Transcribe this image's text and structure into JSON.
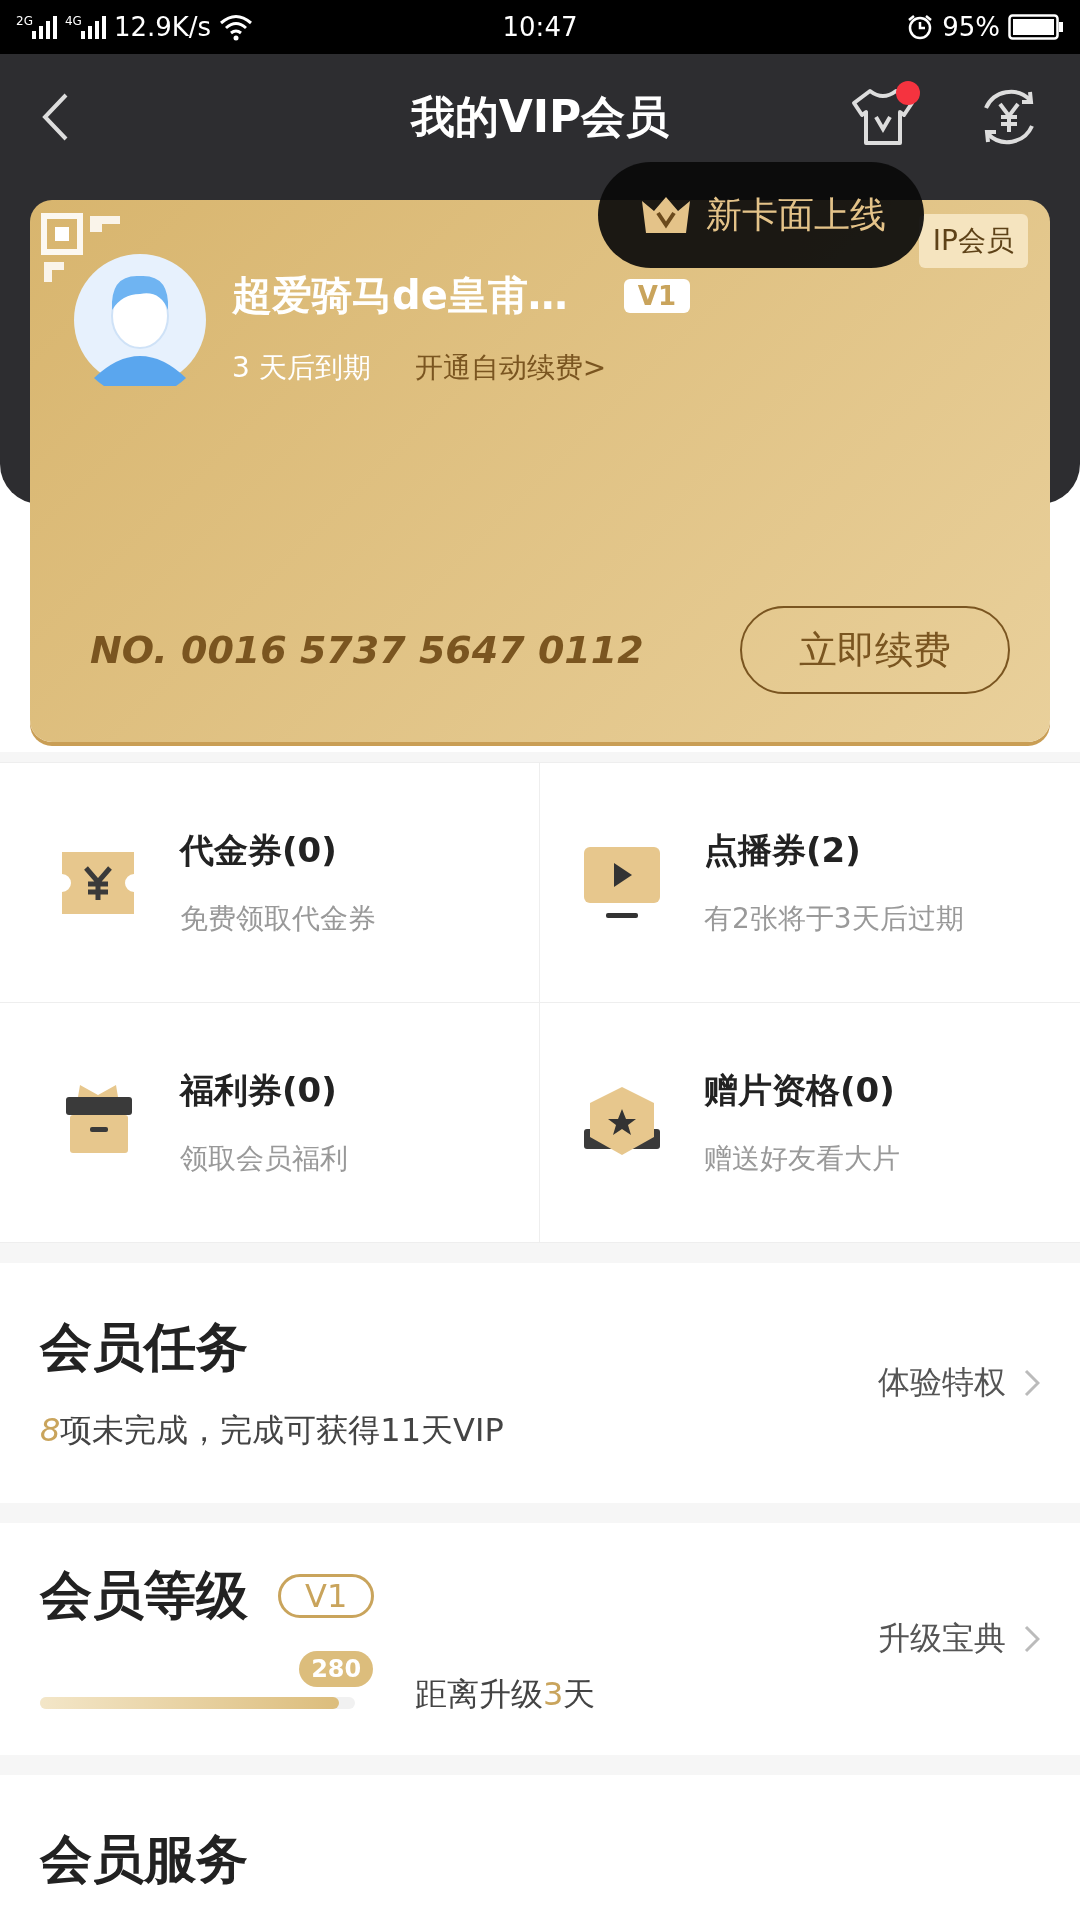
{
  "status_bar": {
    "networks": [
      "2G",
      "4G"
    ],
    "speed": "12.9K/s",
    "time": "10:47",
    "battery": "95%"
  },
  "header": {
    "title": "我的VIP会员",
    "has_notification": true
  },
  "tooltip": {
    "text": "新卡面上线"
  },
  "card": {
    "badge": "IP会员",
    "name": "超爱骑马de皇甫…",
    "level_badge": "V1",
    "expiry": "3 天后到期",
    "auto_renew_link": "开通自动续费>",
    "number": "NO. 0016 5737 5647 0112",
    "renew_button": "立即续费"
  },
  "coupons": [
    {
      "kind": "voucher",
      "title": "代金券(0)",
      "subtitle": "免费领取代金券"
    },
    {
      "kind": "play",
      "title": "点播券(2)",
      "subtitle": "有2张将于3天后过期"
    },
    {
      "kind": "gift",
      "title": "福利券(0)",
      "subtitle": "领取会员福利"
    },
    {
      "kind": "star",
      "title": "赠片资格(0)",
      "subtitle": "赠送好友看大片"
    }
  ],
  "tasks": {
    "title": "会员任务",
    "count": "8",
    "text": "项未完成，完成可获得11天VIP",
    "link": "体验特权"
  },
  "level": {
    "title": "会员等级",
    "badge": "V1",
    "points": "280",
    "level": 0.95,
    "prefix": "距离升级",
    "days": "3",
    "suffix": "天",
    "link": "升级宝典"
  },
  "services": {
    "title": "会员服务"
  }
}
